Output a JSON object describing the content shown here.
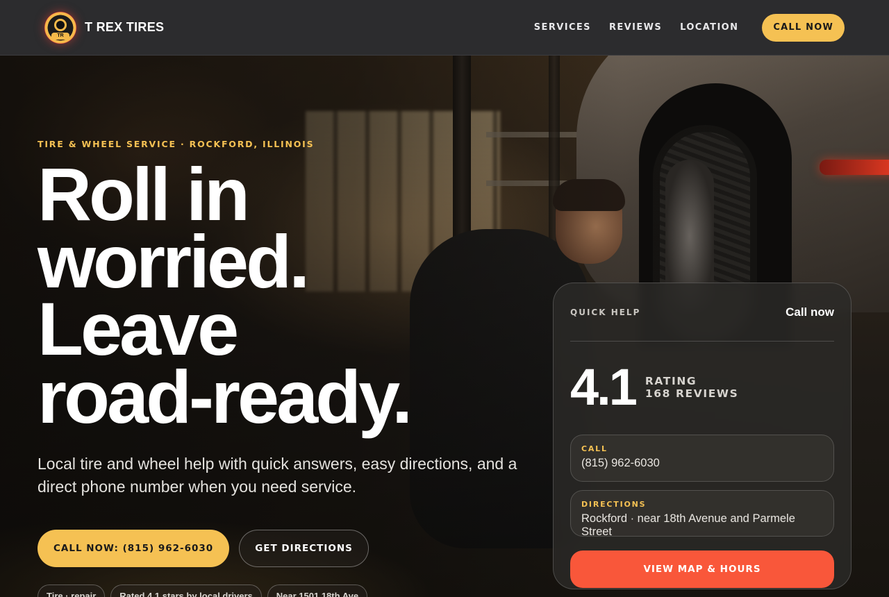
{
  "header": {
    "brand_name": "T REX TIRES",
    "logo_tag": "TR",
    "nav": [
      {
        "label": "SERVICES"
      },
      {
        "label": "REVIEWS"
      },
      {
        "label": "LOCATION"
      }
    ],
    "call_label": "CALL NOW"
  },
  "hero": {
    "eyebrow": "TIRE & WHEEL SERVICE · ROCKFORD, ILLINOIS",
    "headline": [
      "Roll in",
      "worried.",
      "Leave",
      "road-ready."
    ],
    "lede": "Local tire and wheel help with quick answers, easy directions, and a direct phone number when you need service.",
    "cta_primary": "CALL NOW: (815) 962-6030",
    "cta_secondary": "GET DIRECTIONS",
    "chips": [
      {
        "label": "Tire · repair"
      },
      {
        "label": "Rated 4.1 stars by local drivers"
      },
      {
        "label": "Near 1501 18th Ave"
      }
    ]
  },
  "card": {
    "label": "QUICK HELP",
    "call_link": "Call now",
    "rating": "4.1",
    "rating_label": "RATING",
    "reviews_label": "168 REVIEWS",
    "call": {
      "label": "CALL",
      "value": "(815) 962-6030"
    },
    "directions": {
      "label": "DIRECTIONS",
      "value": "Rockford · near 18th Avenue and Parmele Street"
    },
    "map_button": "VIEW MAP & HOURS"
  },
  "colors": {
    "accent_yellow": "#f5c153",
    "accent_orange": "#f9573a",
    "header_bg": "#2c2c2e"
  }
}
